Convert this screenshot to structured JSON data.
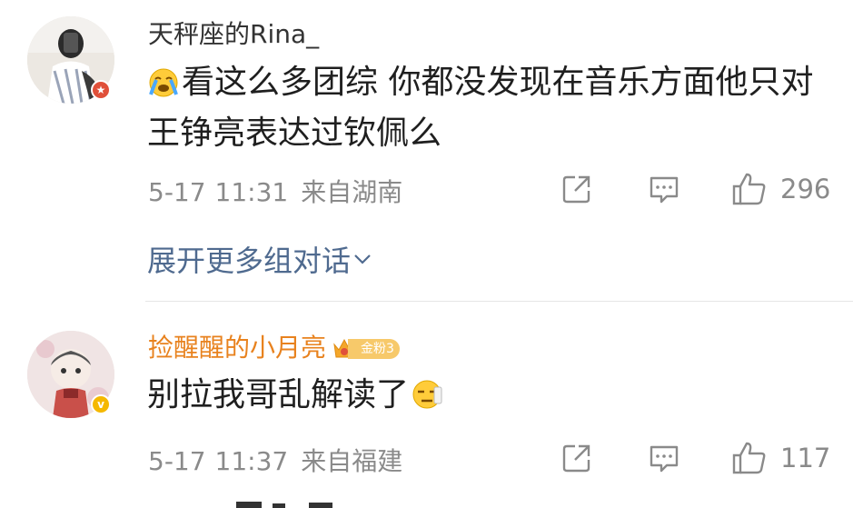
{
  "comments": [
    {
      "username": "天秤座的Rina_",
      "content": "看这么多团综 你都没发现在音乐方面他只对王铮亮表达过钦佩么",
      "content_emoji": "sob-emoji",
      "date": "5-17",
      "time": "11:31",
      "location": "来自湖南",
      "likes": "296",
      "username_color": "#333333",
      "badge_color": "#e0503a"
    },
    {
      "username": "捡醒醒的小月亮",
      "fan_badge": "金粉3",
      "content": "别拉我哥乱解读了",
      "content_emoji": "smirk-emoji",
      "date": "5-17",
      "time": "11:37",
      "location": "来自福建",
      "likes": "117",
      "username_color": "#e8821e",
      "badge_color": "#f5b800",
      "badge_glyph": "v"
    }
  ],
  "expand_link": "展开更多组对话",
  "colors": {
    "link": "#4f6a8f",
    "meta": "#8a8a8a",
    "divider": "#e6e6e6"
  }
}
